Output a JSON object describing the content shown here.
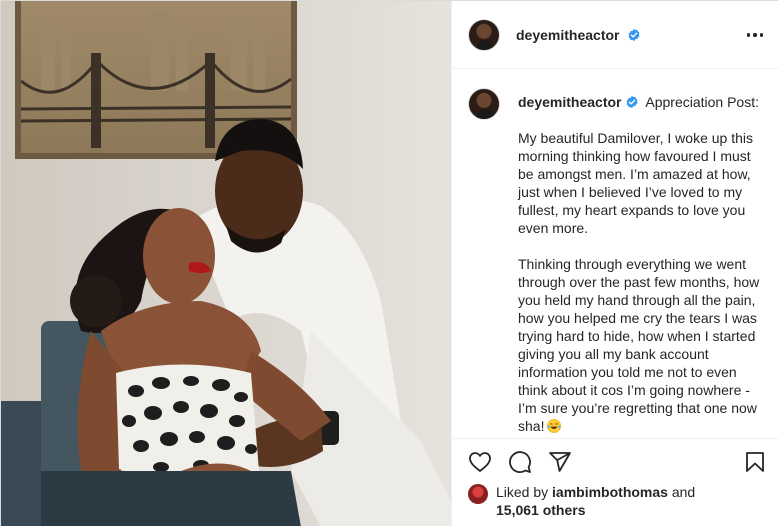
{
  "post": {
    "author": "deyemitheactor",
    "verified": true,
    "caption": {
      "title": "Appreciation Post:",
      "paragraphs": [
        "My beautiful Damilover, I woke up this morning thinking how favoured I must be amongst men. I’m amazed at how, just when I believed I’ve loved to my fullest, my heart expands to love you even more.",
        "Thinking through everything we went through over the past few months, how you held my hand through all the pain, how you helped me cry the tears I was trying hard to hide, how when I started giving you all my bank account information you told me not to even think about it cos I’m going nowhere - I’m sure you’re regretting that one now sha!"
      ],
      "emoji": "laughing-tears-emoji"
    },
    "likes": {
      "prefix": "Liked by",
      "liked_by": "iambimbothomas",
      "connector": "and",
      "others": "15,061 others"
    },
    "icons": {
      "more": "more-options-icon",
      "like": "heart-icon",
      "comment": "comment-icon",
      "share": "share-icon",
      "save": "bookmark-icon",
      "verified": "verified-badge-icon"
    },
    "colors": {
      "verified": "#3897f0",
      "text": "#262626",
      "border": "#efefef"
    }
  }
}
